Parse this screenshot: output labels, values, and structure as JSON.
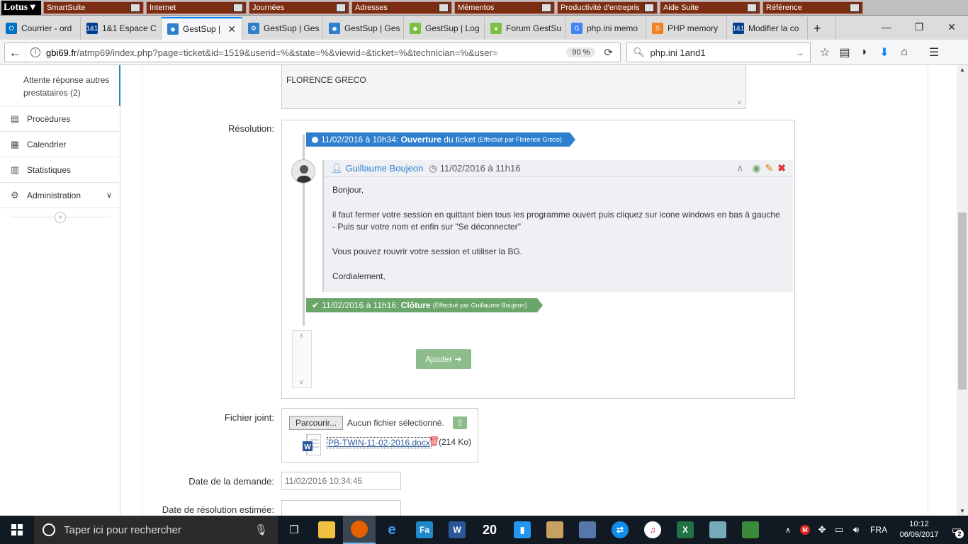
{
  "lotus_bar": {
    "logo": "Lotus",
    "items": [
      "SmartSuite",
      "Internet",
      "Journées",
      "Adresses",
      "Mémentos",
      "Productivité d'entrepris",
      "Aide Suite",
      "Référence"
    ]
  },
  "tabs": [
    {
      "label": "Courrier - ord",
      "fav": "O",
      "color": "#0072c6"
    },
    {
      "label": "1&1 Espace C",
      "fav": "1&1",
      "color": "#003d8f"
    },
    {
      "label": "GestSup |",
      "fav": "◆",
      "color": "#2f7fcf",
      "active": true
    },
    {
      "label": "GestSup | Ges",
      "fav": "⚙",
      "color": "#2f7fcf"
    },
    {
      "label": "GestSup | Ges",
      "fav": "◆",
      "color": "#2f7fcf"
    },
    {
      "label": "GestSup | Log",
      "fav": "◆",
      "color": "#7bc043"
    },
    {
      "label": "Forum GestSu",
      "fav": "●",
      "color": "#7bc043"
    },
    {
      "label": "php.ini memo",
      "fav": "G",
      "color": "#4285f4"
    },
    {
      "label": "PHP memory",
      "fav": "S",
      "color": "#f48024"
    },
    {
      "label": "Modifier la co",
      "fav": "1&1",
      "color": "#003d8f"
    }
  ],
  "navbar": {
    "url_host": "gbi69.fr",
    "url_path": "/atmp69/index.php?page=ticket&id=1519&userid=%&state=%&viewid=&ticket=%&technician=%&user=",
    "zoom": "90 %",
    "search": "php.ini 1and1"
  },
  "sidebar": {
    "sub_item": "Attente réponse autres prestataires (2)",
    "items": [
      {
        "label": "Procédures",
        "icon": "list-icon"
      },
      {
        "label": "Calendrier",
        "icon": "calendar-icon"
      },
      {
        "label": "Statistiques",
        "icon": "chart-icon"
      },
      {
        "label": "Administration",
        "icon": "cogs-icon"
      }
    ],
    "collapse": "«"
  },
  "ticket": {
    "requester": "FLORENCE GRECO",
    "labels": {
      "resolution": "Résolution:",
      "attachment": "Fichier joint:",
      "request_date": "Date de la demande:",
      "estimated_date": "Date de résolution estimée:"
    },
    "timeline_open": {
      "date": "11/02/2016 à 10h34:",
      "action": "Ouverture",
      "suffix": "du ticket",
      "by": "(Effectué par Florence Greco)"
    },
    "followup": {
      "author": "Guillaume Boujeon",
      "date": "11/02/2016 à 11h16",
      "body": [
        "Bonjour,",
        "il faut fermer votre session en quittant bien tous les programme ouvert puis cliquez sur icone windows en bas à gauche - Puis sur votre nom et enfin sur \"Se déconnecter\"",
        "Vous pouvez rouvrir votre session et utiliser la BG.",
        "Cordialement,"
      ]
    },
    "timeline_close": {
      "date": "11/02/2016 à 11h16:",
      "action": "Clôture",
      "by": "(Effectué par Guillaume Boujeon)"
    },
    "add_button": "Ajouter",
    "file": {
      "browse": "Parcourir...",
      "none": "Aucun fichier sélectionné.",
      "name": "PB-TWIN-11-02-2016.docx",
      "size": "(214 Ko)"
    },
    "request_date": "11/02/2016 10:34:45",
    "estimated_date": ""
  },
  "taskbar": {
    "search_placeholder": "Taper ici pour rechercher",
    "lang": "FRA",
    "time": "10:12",
    "date": "06/09/2017",
    "notif": "2"
  },
  "colors": {
    "accent": "#2f7fcf",
    "success": "#6aa56a",
    "danger": "#d33"
  }
}
